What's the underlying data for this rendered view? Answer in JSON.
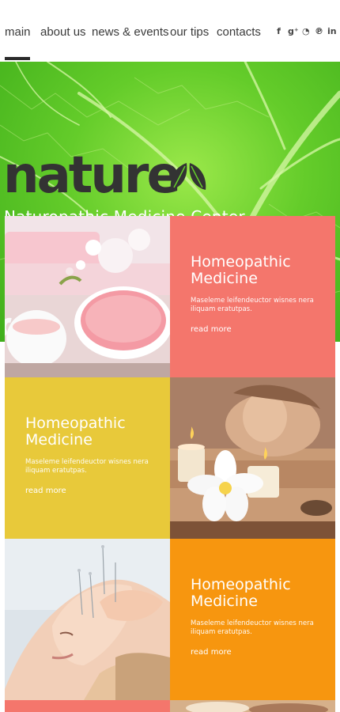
{
  "nav": {
    "items": [
      {
        "label": "main"
      },
      {
        "label": "about us"
      },
      {
        "label": "news & events"
      },
      {
        "label": "our tips"
      },
      {
        "label": "contacts"
      }
    ],
    "socials": [
      {
        "glyph": "f",
        "icon": "facebook-icon"
      },
      {
        "glyph": "g⁺",
        "icon": "google-plus-icon"
      },
      {
        "glyph": "◔",
        "icon": "rss-icon"
      },
      {
        "glyph": "℗",
        "icon": "pinterest-icon"
      },
      {
        "glyph": "in",
        "icon": "linkedin-icon"
      }
    ]
  },
  "hero": {
    "logo": "nature",
    "tagline": "Naturopathic Medicine Center"
  },
  "tiles": [
    {
      "title": "Homeopathic Medicine",
      "desc": "Maseleme leifendeuctor wisnes nera iliquam eratutpas.",
      "more": "read more",
      "color": "#f4766c"
    },
    {
      "title": "Homeopathic Medicine",
      "desc": "Maseleme leifendeuctor wisnes nera iliquam eratutpas.",
      "more": "read more",
      "color": "#e8c93a"
    },
    {
      "title": "Homeopathic Medicine",
      "desc": "Maseleme leifendeuctor wisnes nera iliquam eratutpas.",
      "more": "read more",
      "color": "#f7960f"
    }
  ],
  "colors": {
    "nav_text": "#3a3a3a",
    "leaf_green": "#64cc2a",
    "coral": "#f4766c",
    "yellow": "#e8c93a",
    "orange": "#f7960f"
  }
}
